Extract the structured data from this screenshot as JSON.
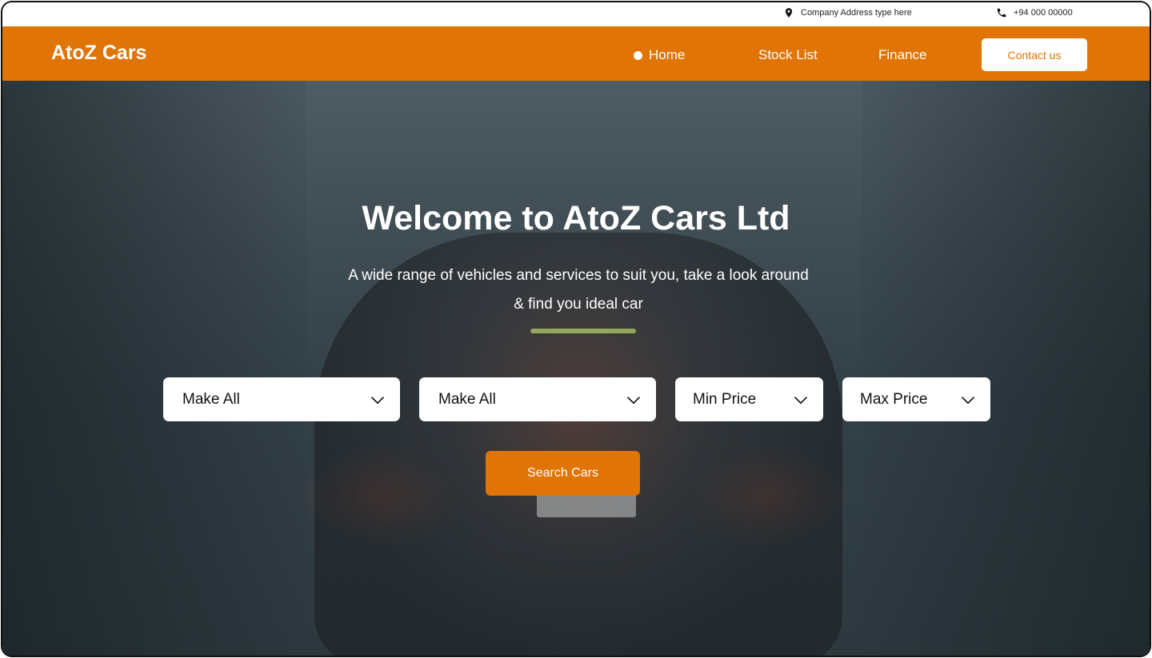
{
  "topbar": {
    "address": "Company Address type here",
    "phone": "+94 000 00000",
    "address_icon": "location-pin-icon",
    "phone_icon": "phone-icon"
  },
  "nav": {
    "logo": "AtoZ Cars",
    "links": [
      "Home",
      "Stock List",
      "Finance"
    ],
    "active": "Home",
    "contact_label": "Contact us"
  },
  "hero": {
    "title": "Welcome to AtoZ Cars Ltd",
    "subtitle": "A wide range of vehicles and services to suit you, take a look around & find you ideal car",
    "filters": [
      "Make All",
      "Make All",
      "Min Price",
      "Max Price"
    ],
    "search_label": "Search Cars"
  },
  "colors": {
    "accent": "#e07406",
    "white": "#ffffff"
  }
}
